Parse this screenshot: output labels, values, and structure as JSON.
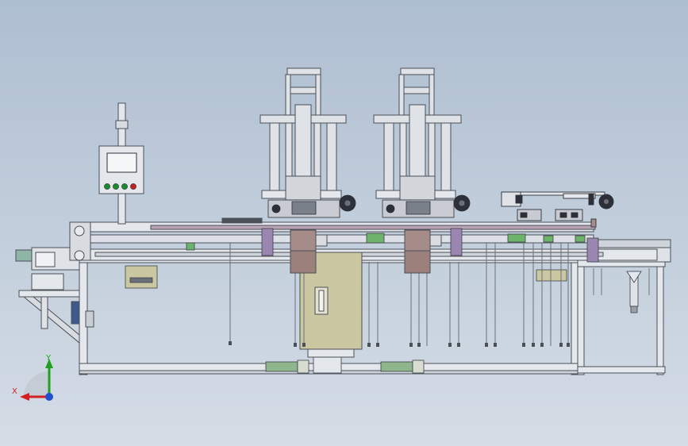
{
  "colors": {
    "background_top": "#aebed1",
    "background_bottom": "#d5dde6",
    "frame": "#e4e7ec",
    "frame_outline": "#4a4f58",
    "cylinder": "#dfe2e6",
    "fixture_block": "#a58c88",
    "cabinet": "#cbc7a0",
    "conveyor_belt": "#b9a3b4",
    "green_accent": "#6db36b",
    "purple_accent": "#9a86b0",
    "axis_x": "#d42020",
    "axis_y": "#20a020",
    "axis_z": "#2050d0"
  },
  "panel_buttons": [
    "#1c8a2c",
    "#1c8a2c",
    "#1c8a2c",
    "#c42020"
  ],
  "triad": {
    "x_label": "X",
    "y_label": "Y"
  }
}
